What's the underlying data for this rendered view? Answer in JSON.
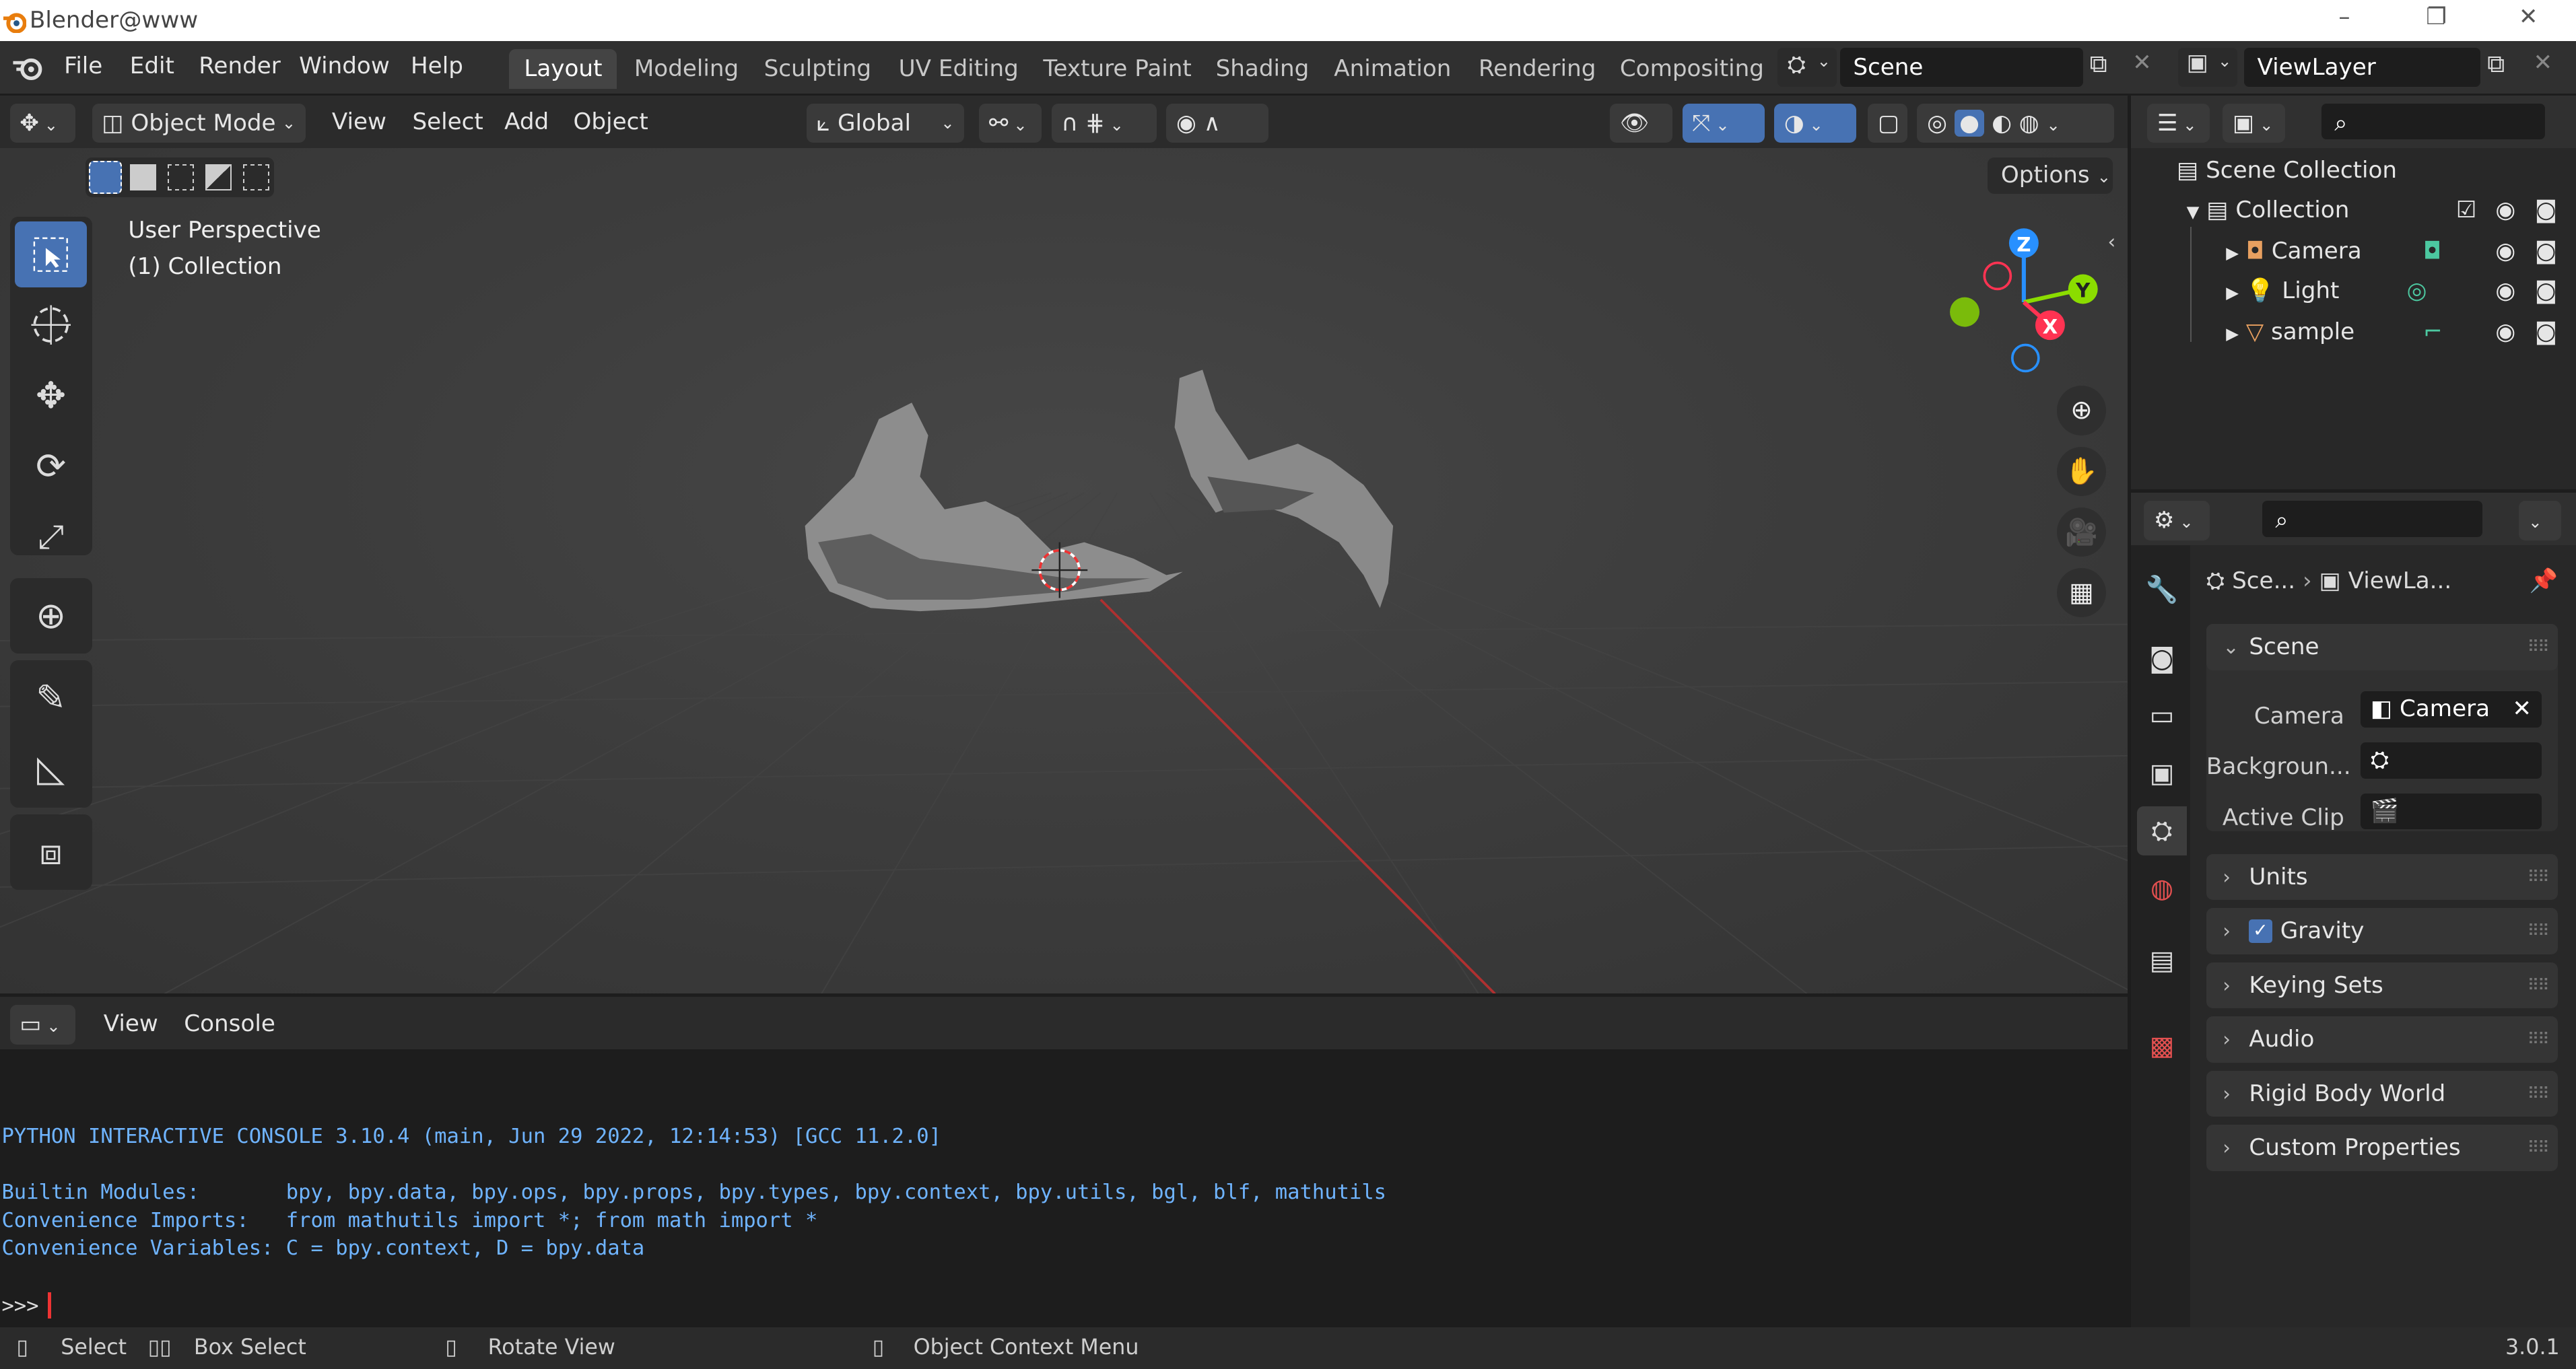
{
  "window": {
    "title": "Blender@www"
  },
  "menu": [
    "File",
    "Edit",
    "Render",
    "Window",
    "Help"
  ],
  "workspaces": [
    "Layout",
    "Modeling",
    "Sculpting",
    "UV Editing",
    "Texture Paint",
    "Shading",
    "Animation",
    "Rendering",
    "Compositing"
  ],
  "active_workspace": "Layout",
  "scene_field": "Scene",
  "viewlayer_field": "ViewLayer",
  "viewport_header": {
    "mode": "Object Mode",
    "menus": [
      "View",
      "Select",
      "Add",
      "Object"
    ],
    "transform": "Global",
    "options_label": "Options"
  },
  "viewport": {
    "perspective_label": "User Perspective",
    "collection_label": "(1) Collection",
    "gizmo_axes": {
      "z": "Z",
      "y": "Y",
      "x": "X"
    }
  },
  "console": {
    "menus": [
      "View",
      "Console"
    ],
    "lines": [
      "PYTHON INTERACTIVE CONSOLE 3.10.4 (main, Jun 29 2022, 12:14:53) [GCC 11.2.0]",
      "Builtin Modules:       bpy, bpy.data, bpy.ops, bpy.props, bpy.types, bpy.context, bpy.utils, bgl, blf, mathutils",
      "Convenience Imports:   from mathutils import *; from math import *",
      "Convenience Variables: C = bpy.context, D = bpy.data"
    ],
    "prompt": ">>> "
  },
  "outliner": {
    "root": "Scene Collection",
    "collection": "Collection",
    "items": [
      "Camera",
      "Light",
      "sample"
    ]
  },
  "properties": {
    "breadcrumb_scene": "Sce...",
    "breadcrumb_viewlayer": "ViewLa...",
    "scene_panel": "Scene",
    "camera_label": "Camera",
    "camera_value": "Camera",
    "background_label": "Backgroun...",
    "active_clip_label": "Active Clip",
    "panels": [
      "Units",
      "Gravity",
      "Keying Sets",
      "Audio",
      "Rigid Body World",
      "Custom Properties"
    ],
    "gravity_checked": true
  },
  "statusbar": {
    "select": "Select",
    "box_select": "Box Select",
    "rotate_view": "Rotate View",
    "context_menu": "Object Context Menu",
    "version": "3.0.1"
  },
  "colors": {
    "accent": "#4772b3",
    "x_axis": "#ff3352",
    "y_axis": "#8bdc00",
    "z_axis": "#2890ff",
    "console_text": "#6fb4ff"
  }
}
